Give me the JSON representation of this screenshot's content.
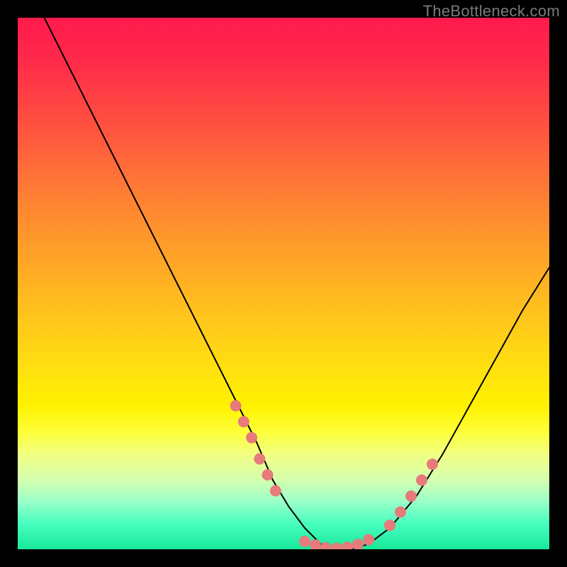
{
  "watermark": "TheBottleneck.com",
  "chart_data": {
    "type": "line",
    "title": "",
    "xlabel": "",
    "ylabel": "",
    "xlim": [
      0,
      100
    ],
    "ylim": [
      0,
      100
    ],
    "series": [
      {
        "name": "bottleneck-curve",
        "x": [
          5,
          10,
          15,
          20,
          25,
          30,
          35,
          40,
          45,
          48,
          51,
          54,
          57,
          60,
          63,
          66,
          70,
          75,
          80,
          85,
          90,
          95,
          100
        ],
        "y": [
          100,
          90,
          80,
          70,
          60,
          50,
          40,
          30,
          20,
          13,
          8,
          4,
          1,
          0,
          0,
          1,
          4,
          10,
          18,
          27,
          36,
          45,
          53
        ]
      }
    ],
    "markers": {
      "name": "highlight-dots",
      "color": "#e77a7a",
      "points": [
        {
          "x": 41,
          "y": 27
        },
        {
          "x": 42.5,
          "y": 24
        },
        {
          "x": 44,
          "y": 21
        },
        {
          "x": 45.5,
          "y": 17
        },
        {
          "x": 47,
          "y": 14
        },
        {
          "x": 48.5,
          "y": 11
        },
        {
          "x": 54,
          "y": 1.5
        },
        {
          "x": 56,
          "y": 0.8
        },
        {
          "x": 58,
          "y": 0.3
        },
        {
          "x": 60,
          "y": 0.2
        },
        {
          "x": 62,
          "y": 0.4
        },
        {
          "x": 64,
          "y": 0.9
        },
        {
          "x": 66,
          "y": 1.8
        },
        {
          "x": 70,
          "y": 4.5
        },
        {
          "x": 72,
          "y": 7
        },
        {
          "x": 74,
          "y": 10
        },
        {
          "x": 76,
          "y": 13
        },
        {
          "x": 78,
          "y": 16
        }
      ]
    },
    "background": {
      "type": "vertical-gradient",
      "stops": [
        {
          "pos": 0,
          "color": "#ff1a4d"
        },
        {
          "pos": 20,
          "color": "#ff5040"
        },
        {
          "pos": 44,
          "color": "#ffa028"
        },
        {
          "pos": 66,
          "color": "#ffe010"
        },
        {
          "pos": 82,
          "color": "#f2ff80"
        },
        {
          "pos": 100,
          "color": "#18e89a"
        }
      ]
    }
  }
}
